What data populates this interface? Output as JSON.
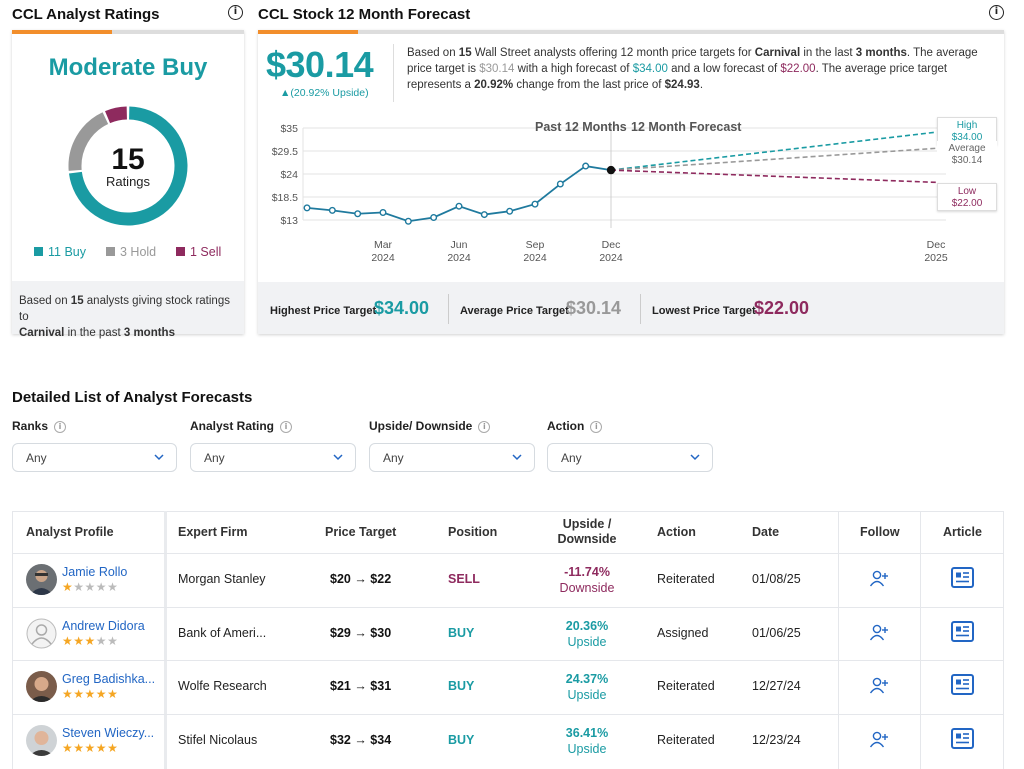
{
  "ratings": {
    "title": "CCL Analyst Ratings",
    "consensus": "Moderate Buy",
    "count": "15",
    "count_label": "Ratings",
    "legend": [
      {
        "label": "11 Buy",
        "color": "#1a9ba3"
      },
      {
        "label": "3 Hold",
        "color": "#999999"
      },
      {
        "label": "1 Sell",
        "color": "#8e2a5e"
      }
    ],
    "footer_pre": "Based on ",
    "footer_n": "15",
    "footer_mid": " analysts giving stock ratings to",
    "footer_company": "Carnival",
    "footer_mid2": " in the past ",
    "footer_period": "3 months",
    "donut": {
      "buy": 11,
      "hold": 3,
      "sell": 1
    }
  },
  "forecast": {
    "title": "CCL Stock 12 Month Forecast",
    "price": "$30.14",
    "upside": "▲(20.92% Upside)",
    "desc": {
      "t1": "Based on ",
      "n": "15",
      "t2": " Wall Street analysts offering 12 month price targets for ",
      "company": "Carnival",
      "t3": " in the last ",
      "period": "3 months",
      "t4": ". The average price target is ",
      "avg": "$30.14",
      "t5": " with a high forecast of ",
      "high": "$34.00",
      "t6": " and a low forecast of ",
      "low": "$22.00",
      "t7": ". The average price target represents a ",
      "pct": "20.92%",
      "t8": " change from the last price of ",
      "last": "$24.93",
      "t9": "."
    },
    "chart_header_left": "Past 12 Months",
    "chart_header_right": "12 Month Forecast",
    "high_label": "High",
    "high_value": "$34.00",
    "avg_label": "Average",
    "avg_value": "$30.14",
    "low_label": "Low",
    "low_value": "$22.00",
    "summary": {
      "high_label": "Highest Price Target",
      "high_value": "$34.00",
      "avg_label": "Average Price Target",
      "avg_value": "$30.14",
      "low_label": "Lowest Price Target",
      "low_value": "$22.00"
    }
  },
  "chart_data": {
    "type": "line",
    "y_ticks": [
      "$35",
      "$29.5",
      "$24",
      "$18.5",
      "$13"
    ],
    "y_tick_values": [
      35,
      29.5,
      24,
      18.5,
      13
    ],
    "ylim": [
      13,
      35
    ],
    "x_ticks": [
      {
        "month": "Mar",
        "year": "2024",
        "t": 3
      },
      {
        "month": "Jun",
        "year": "2024",
        "t": 6
      },
      {
        "month": "Sep",
        "year": "2024",
        "t": 9
      },
      {
        "month": "Dec",
        "year": "2024",
        "t": 12
      },
      {
        "month": "Dec",
        "year": "2025",
        "t": 24
      }
    ],
    "series": [
      {
        "name": "",
        "color": "#1f7a9e",
        "x": [
          0,
          1,
          2,
          3,
          4,
          5,
          6,
          7,
          8,
          9,
          10,
          11,
          12
        ],
        "values": [
          15.9,
          15.3,
          14.5,
          14.8,
          12.7,
          13.6,
          16.3,
          14.3,
          15.1,
          16.8,
          21.6,
          25.9,
          24.93
        ]
      }
    ],
    "forecast": [
      {
        "name": "High",
        "value": 34.0,
        "color": "#1a9ba3"
      },
      {
        "name": "Average",
        "value": 30.14,
        "color": "#999999"
      },
      {
        "name": "Low",
        "value": 22.0,
        "color": "#8e2a5e"
      }
    ]
  },
  "detail": {
    "title": "Detailed List of Analyst Forecasts",
    "filters": [
      {
        "label": "Ranks",
        "value": "Any"
      },
      {
        "label": "Analyst Rating",
        "value": "Any"
      },
      {
        "label": "Upside/ Downside",
        "value": "Any"
      },
      {
        "label": "Action",
        "value": "Any"
      }
    ],
    "columns": {
      "profile": "Analyst Profile",
      "firm": "Expert Firm",
      "target": "Price Target",
      "position": "Position",
      "ud1": "Upside /",
      "ud2": "Downside",
      "action": "Action",
      "date": "Date",
      "follow": "Follow",
      "article": "Article"
    },
    "rows": [
      {
        "name": "Jamie Rollo",
        "stars": 1,
        "firm": "Morgan Stanley",
        "target": "$20 → $22",
        "position": "SELL",
        "pos_color": "#8e2a5e",
        "pct": "-11.74%",
        "dir": "Downside",
        "ud_color": "#8e2a5e",
        "action": "Reiterated",
        "date": "01/08/25",
        "avatar": "photo-a"
      },
      {
        "name": "Andrew Didora",
        "stars": 3,
        "firm": "Bank of Ameri...",
        "target": "$29 → $30",
        "position": "BUY",
        "pos_color": "#1a9ba3",
        "pct": "20.36%",
        "dir": "Upside",
        "ud_color": "#1a9ba3",
        "action": "Assigned",
        "date": "01/06/25",
        "avatar": "placeholder"
      },
      {
        "name": "Greg Badishka...",
        "stars": 4.5,
        "firm": "Wolfe Research",
        "target": "$21 → $31",
        "position": "BUY",
        "pos_color": "#1a9ba3",
        "pct": "24.37%",
        "dir": "Upside",
        "ud_color": "#1a9ba3",
        "action": "Reiterated",
        "date": "12/27/24",
        "avatar": "photo-b"
      },
      {
        "name": "Steven Wieczy...",
        "stars": 5,
        "firm": "Stifel Nicolaus",
        "target": "$32 → $34",
        "position": "BUY",
        "pos_color": "#1a9ba3",
        "pct": "36.41%",
        "dir": "Upside",
        "ud_color": "#1a9ba3",
        "action": "Reiterated",
        "date": "12/23/24",
        "avatar": "photo-c"
      }
    ]
  }
}
